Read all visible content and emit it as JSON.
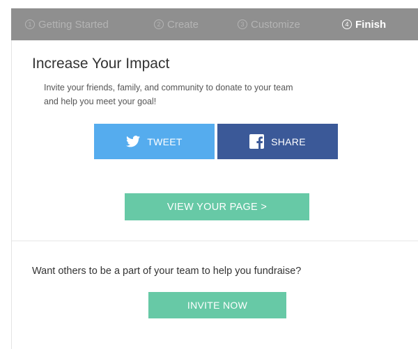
{
  "steps": [
    {
      "num": "1",
      "label": "Getting Started",
      "active": false
    },
    {
      "num": "2",
      "label": "Create",
      "active": false
    },
    {
      "num": "3",
      "label": "Customize",
      "active": false
    },
    {
      "num": "4",
      "label": "Finish",
      "active": true
    }
  ],
  "impact": {
    "heading": "Increase Your Impact",
    "description": "Invite your friends, family, and community to donate to your team and help you meet your goal!"
  },
  "social": {
    "tweet_label": "TWEET",
    "share_label": "SHARE",
    "tweet_icon": "twitter-bird-icon",
    "share_icon": "facebook-icon"
  },
  "view_page_label": "VIEW YOUR PAGE >",
  "invite": {
    "question": "Want others to be a part of your team to help you fundraise?",
    "button_label": "INVITE NOW"
  },
  "colors": {
    "stepbar_bg": "#8f8f8f",
    "twitter": "#55acee",
    "facebook": "#3b5998",
    "accent_green": "#67c9a6"
  }
}
